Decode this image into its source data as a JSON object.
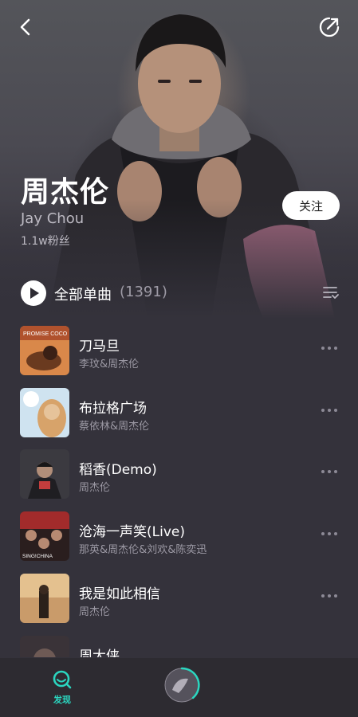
{
  "artist": {
    "name": "周杰伦",
    "name_en": "Jay Chou",
    "fans": "1.1w粉丝",
    "follow_label": "关注"
  },
  "all_songs": {
    "label": "全部单曲",
    "count": "(1391)"
  },
  "songs": [
    {
      "title": "刀马旦",
      "artist": "李玟&周杰伦",
      "cover_text": "PROMISE COCO"
    },
    {
      "title": "布拉格广场",
      "artist": "蔡依林&周杰伦"
    },
    {
      "title": "稻香(Demo)",
      "artist": "周杰伦"
    },
    {
      "title": "沧海一声笑(Live)",
      "artist": "那英&周杰伦&刘欢&陈奕迅",
      "cover_text": "SING!CHINA"
    },
    {
      "title": "我是如此相信",
      "artist": "周杰伦"
    },
    {
      "title": "周大侠",
      "artist": ""
    }
  ],
  "bottom_nav": {
    "discover_label": "发现"
  },
  "colors": {
    "accent": "#2bd6c0",
    "background": "#34323b"
  },
  "icons": [
    "back-icon",
    "share-icon",
    "play-icon",
    "sort-icon",
    "more-icon",
    "search-icon"
  ]
}
